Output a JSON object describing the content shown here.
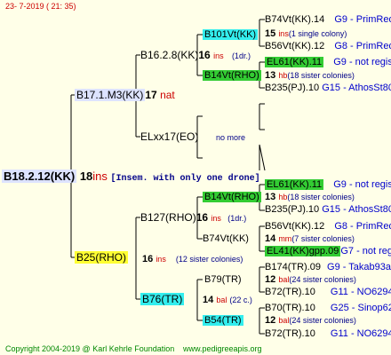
{
  "header": {
    "date": "23-  7-2019 ( 21: 35)"
  },
  "footer": {
    "copyright": "Copyright 2004-2019 @ Karl Kehrle Foundation",
    "site": "www.pedigreeapis.org"
  },
  "root": {
    "id": "B18.2.12(KK)",
    "num": "18",
    "suffix": "ins",
    "note": "[Insem. with only one drone]"
  },
  "sire": {
    "id": "B17.1.M3(KK)",
    "num": "17",
    "suffix": "nat"
  },
  "ss": {
    "id": "B16.2.8(KK)",
    "num": "16",
    "suffix": "ins",
    "note": "(1dr.)"
  },
  "sss": {
    "id": "B101Vt(KK)"
  },
  "sssd": {
    "id": "B74Vt(KK).14",
    "origin": "G9 - PrimRed01"
  },
  "sssr": {
    "num": "15",
    "suffix": "ins",
    "note": "(1 single colony)"
  },
  "ssss": {
    "id": "B56Vt(KK).12",
    "origin": "G8 - PrimRed01"
  },
  "ssd": {
    "id": "B14Vt(RHO)"
  },
  "ssdd": {
    "id": "EL61(KK).11",
    "origin": "G9 - not registe"
  },
  "ssdr": {
    "num": "13",
    "suffix": "hb",
    "note": "(18 sister colonies)"
  },
  "ssds": {
    "id": "B235(PJ).10",
    "origin": "G15 - AthosSt80R"
  },
  "sd": {
    "id": "ELxx17(EO)",
    "note": "no more"
  },
  "dam": {
    "id": "B25(RHO)",
    "num": "16",
    "suffix": "ins",
    "note": "(12 sister colonies)"
  },
  "ds": {
    "id": "B127(RHO)",
    "num": "16",
    "suffix": "ins",
    "note": "(1dr.)"
  },
  "dss": {
    "id": "B14Vt(RHO)"
  },
  "dssd": {
    "id": "EL61(KK).11",
    "origin": "G9 - not registe"
  },
  "dssr": {
    "num": "13",
    "suffix": "hb",
    "note": "(18 sister colonies)"
  },
  "dsss": {
    "id": "B235(PJ).10",
    "origin": "G15 - AthosSt80R"
  },
  "dsd": {
    "id": "B74Vt(KK)"
  },
  "dsdd": {
    "id": "B56Vt(KK).12",
    "origin": "G8 - PrimRed01"
  },
  "dsdr": {
    "num": "14",
    "suffix": "mm",
    "note": "(7 sister colonies)"
  },
  "dsds": {
    "id": "EL41(KK)gpp.09",
    "origin": "G7 - not registe"
  },
  "dd": {
    "id": "B76(TR)",
    "num": "14",
    "suffix": "bal",
    "note": "(22 c.)"
  },
  "dds": {
    "id": "B79(TR)"
  },
  "ddsd": {
    "id": "B174(TR).09",
    "origin": "G9 - Takab93aR"
  },
  "ddsr": {
    "num": "12",
    "suffix": "bal",
    "note": "(24 sister colonies)"
  },
  "ddss": {
    "id": "B72(TR).10",
    "origin": "G11 - NO6294R"
  },
  "ddd": {
    "id": "B54(TR)"
  },
  "dddd": {
    "id": "B70(TR).10",
    "origin": "G25 - Sinop62R"
  },
  "dddr": {
    "num": "12",
    "suffix": "bal",
    "note": "(24 sister colonies)"
  },
  "ddds": {
    "id": "B72(TR).10",
    "origin": "G11 - NO6294R"
  }
}
